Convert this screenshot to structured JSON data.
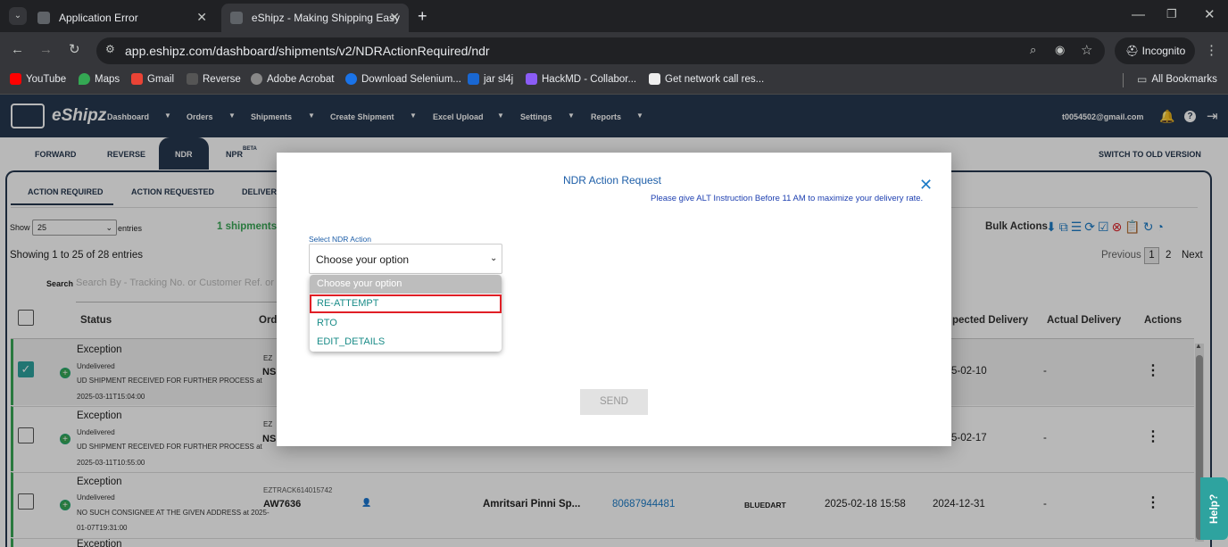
{
  "browser": {
    "tabs": [
      {
        "title": "Application Error"
      },
      {
        "title": "eShipz - Making Shipping Easy"
      }
    ],
    "url": "app.eshipz.com/dashboard/shipments/v2/NDRActionRequired/ndr",
    "profile": "Incognito",
    "bookmarks": [
      "YouTube",
      "Maps",
      "Gmail",
      "Reverse",
      "Adobe Acrobat",
      "Download Selenium...",
      "jar sl4j",
      "HackMD - Collabor...",
      "Get network call res..."
    ],
    "all_bookmarks": "All Bookmarks"
  },
  "app": {
    "logo": "eShipz",
    "nav": [
      "Dashboard",
      "Orders",
      "Shipments",
      "Create Shipment",
      "Excel Upload",
      "Settings",
      "Reports"
    ],
    "user_email": "t0054502@gmail.com"
  },
  "page": {
    "top_tabs": [
      "FORWARD",
      "REVERSE",
      "NDR",
      "NPR"
    ],
    "npr_badge": "BETA",
    "switch_version": "SWITCH TO OLD VERSION",
    "sub_tabs": [
      "ACTION REQUIRED",
      "ACTION REQUESTED",
      "DELIVERE"
    ],
    "show_label": "Show",
    "page_size": "25",
    "entries_label": "entries",
    "shipments_count": "1 shipments",
    "showing": "Showing 1 to 25 of 28 entries",
    "search_label": "Search",
    "search_placeholder": "Search By - Tracking No. or Customer Ref. or",
    "bulk_actions": "Bulk Actions",
    "pagination": {
      "previous": "Previous",
      "pages": [
        "1",
        "2"
      ],
      "next": "Next"
    },
    "columns": {
      "status": "Status",
      "order": "Ord",
      "expected": "pected Delivery",
      "actual": "Actual Delivery",
      "actions": "Actions"
    },
    "rows": [
      {
        "status": "Exception",
        "sub": "Undelivered",
        "detail": "UD SHIPMENT RECEIVED FOR FURTHER PROCESS at",
        "time": "2025-03-11T15:04:00",
        "tracking": "EZ",
        "awb": "NS",
        "expected": "5-02-10",
        "actual": "-"
      },
      {
        "status": "Exception",
        "sub": "Undelivered",
        "detail": "UD SHIPMENT RECEIVED FOR FURTHER PROCESS at",
        "time": "2025-03-11T10:55:00",
        "tracking": "EZ",
        "awb": "NS",
        "expected": "5-02-17",
        "actual": "-"
      },
      {
        "status": "Exception",
        "sub": "Undelivered",
        "detail": "NO SUCH CONSIGNEE AT THE GIVEN ADDRESS at 2025-",
        "time": "01-07T19:31:00",
        "tracking": "EZTRACK614015742",
        "awb": "AW7636",
        "customer": "Amritsari Pinni Sp...",
        "phone": "80687944481",
        "carrier": "BLUEDART",
        "created": "2025-02-18 15:58",
        "expected": "2024-12-31",
        "actual": "-"
      },
      {
        "status": "Exception"
      }
    ]
  },
  "modal": {
    "title": "NDR Action Request",
    "note": "Please give ALT Instruction Before 11 AM to maximize your delivery rate.",
    "select_label": "Select NDR Action",
    "select_value": "Choose your option",
    "options": [
      "Choose your option",
      "RE-ATTEMPT",
      "RTO",
      "EDIT_DETAILS"
    ],
    "send": "SEND"
  },
  "help": "Help?"
}
